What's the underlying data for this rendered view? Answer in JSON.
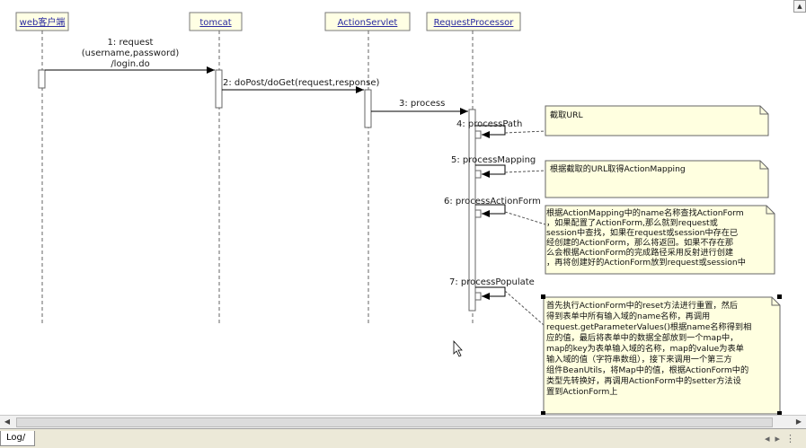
{
  "participants": [
    {
      "id": "web",
      "label": "web客户端"
    },
    {
      "id": "tomcat",
      "label": "tomcat"
    },
    {
      "id": "servlet",
      "label": "ActionServlet"
    },
    {
      "id": "rp",
      "label": "RequestProcessor"
    }
  ],
  "messages": [
    {
      "id": "m1",
      "lines": [
        "1: request",
        "(username,password)",
        "/login.do"
      ]
    },
    {
      "id": "m2",
      "lines": [
        "2: doPost/doGet(request,response)"
      ]
    },
    {
      "id": "m3",
      "lines": [
        "3: process"
      ]
    },
    {
      "id": "m4",
      "lines": [
        "4: processPath"
      ]
    },
    {
      "id": "m5",
      "lines": [
        "5: processMapping"
      ]
    },
    {
      "id": "m6",
      "lines": [
        "6: processActionForm"
      ]
    },
    {
      "id": "m7",
      "lines": [
        "7: processPopulate"
      ]
    }
  ],
  "notes": [
    {
      "id": "n1",
      "lines": [
        "截取URL"
      ]
    },
    {
      "id": "n2",
      "lines": [
        "根据截取的URL取得ActionMapping"
      ]
    },
    {
      "id": "n3",
      "lines": [
        "根据ActionMapping中的name名称查找ActionForm",
        "，如果配置了ActionForm,那么就到request或",
        "session中查找，如果在request或session中存在已",
        "经创建的ActionForm，那么将返回。如果不存在那",
        "么会根据ActionForm的完成路径采用反射进行创建",
        "，再将创建好的ActionForm放到request或session中"
      ]
    },
    {
      "id": "n4",
      "lines": [
        "首先执行ActionForm中的reset方法进行重置，然后",
        "得到表单中所有输入域的name名称，再调用",
        "request.getParameterValues()根据name名称得到相",
        "应的值，最后将表单中的数据全部放到一个map中，",
        "map的key为表单输入域的名称，map的value为表单",
        "输入域的值（字符串数组），接下来调用一个第三方",
        "组件BeanUtils，将Map中的值，根据ActionForm中的",
        "类型先转换好，再调用ActionForm中的setter方法设",
        "置到ActionForm上"
      ]
    }
  ],
  "tab": {
    "label": "Log/"
  }
}
